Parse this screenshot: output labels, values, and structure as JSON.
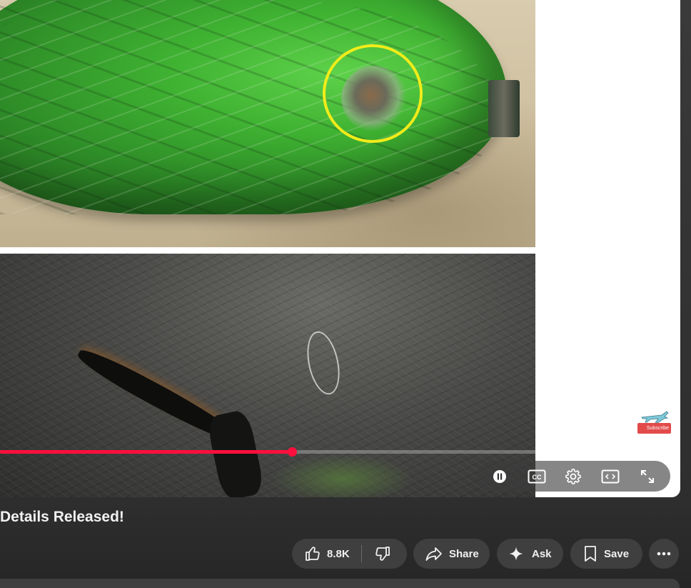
{
  "video": {
    "title": "Details Released!",
    "progress_fraction": 0.435,
    "watermark_label": "Subscribe"
  },
  "controls": {
    "pause_icon": "pause-icon",
    "cc_icon": "closed-captions-icon",
    "settings_icon": "gear-icon",
    "miniplayer_icon": "miniplayer-icon",
    "fullscreen_icon": "fullscreen-icon"
  },
  "actions": {
    "like_count": "8.8K",
    "share_label": "Share",
    "ask_label": "Ask",
    "save_label": "Save"
  },
  "colors": {
    "progress": "#ff0f3d",
    "annotation_circle": "#f2ec1a",
    "button_bg": "#3f3f3f"
  }
}
